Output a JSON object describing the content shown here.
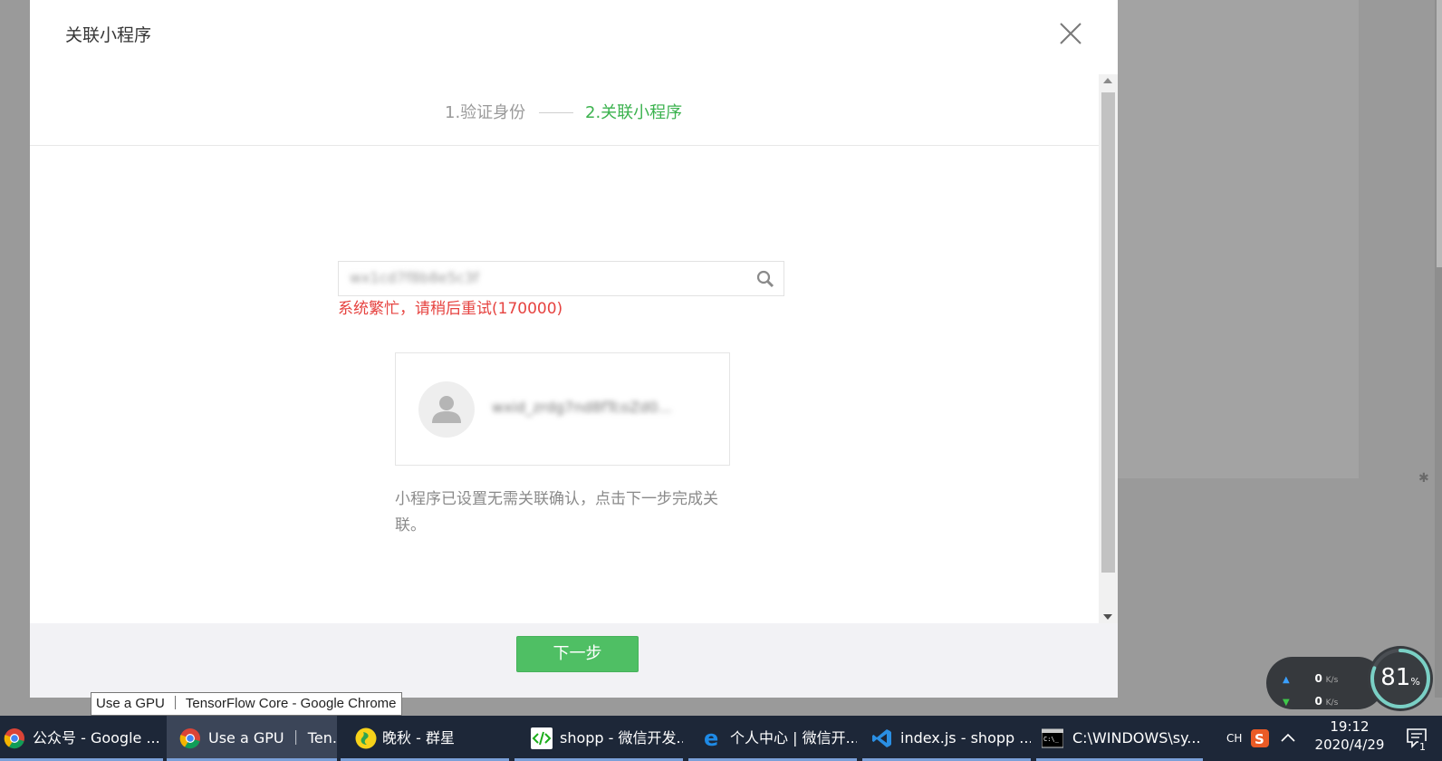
{
  "dialog": {
    "title": "关联小程序",
    "steps": {
      "step1": "1.验证身份",
      "step2": "2.关联小程序"
    },
    "search": {
      "value": "wx1cd7f8b8e5c3f",
      "error": "系统繁忙，请稍后重试(170000)"
    },
    "card": {
      "name": "wxid_zrdg7nd8fTcoZd0..."
    },
    "hint": "小程序已设置无需关联确认，点击下一步完成关联。",
    "next_button": "下一步"
  },
  "tooltip": "Use a GPU ｜ TensorFlow Core - Google Chrome",
  "net_widget": {
    "up_value": "0",
    "up_unit": "K/s",
    "down_value": "0",
    "down_unit": "K/s",
    "gauge_value": "81",
    "gauge_unit": "%",
    "gauge_level": 0.81
  },
  "taskbar": {
    "tasks": [
      {
        "label": "公众号 - Google ...",
        "icon": "chrome-icon"
      },
      {
        "label": "Use a GPU ｜ Ten...",
        "icon": "chrome-icon"
      },
      {
        "label": "晚秋 - 群星",
        "icon": "music-player-icon"
      },
      {
        "label": "shopp - 微信开发...",
        "icon": "wechat-devtools-icon"
      },
      {
        "label": "个人中心 | 微信开...",
        "icon": "edge-icon"
      },
      {
        "label": "index.js - shopp ...",
        "icon": "vscode-icon"
      },
      {
        "label": "C:\\WINDOWS\\sy...",
        "icon": "cmd-icon"
      }
    ],
    "ime": "CH",
    "time": "19:12",
    "date": "2020/4/29",
    "notification_count": "1"
  }
}
